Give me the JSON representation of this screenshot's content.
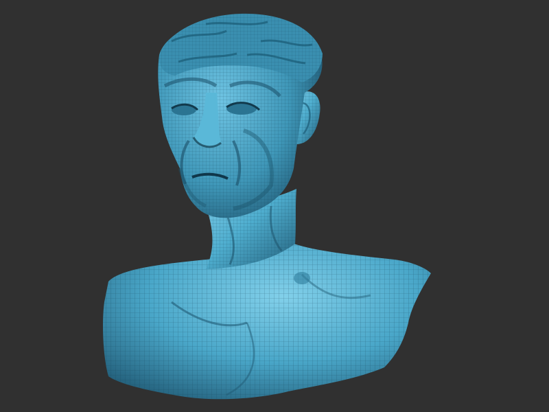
{
  "viewport": {
    "background_color": "#303030",
    "model": {
      "subject": "bust-sculpt",
      "material_color": "#4faecf",
      "shadow_color": "#1d5d78",
      "highlight_color": "#8fd6ef",
      "wire_color": "#143f53"
    }
  }
}
